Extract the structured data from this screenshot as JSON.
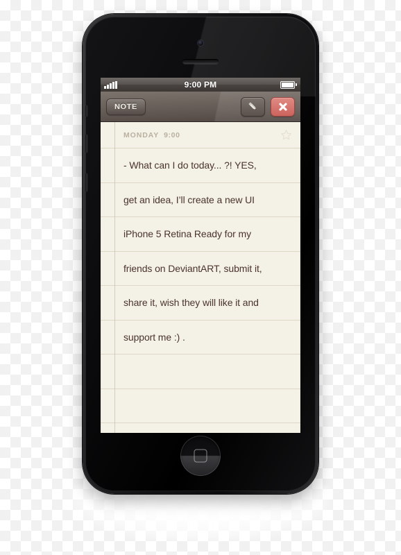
{
  "device": {
    "name": "iPhone 5 Black",
    "body_color": "#0c0c0e",
    "camera_icon": "front-camera-icon",
    "earpiece_icon": "earpiece-speaker-icon",
    "home_button_icon": "home-button-icon"
  },
  "status_bar": {
    "signal_icon": "signal-bars-icon",
    "signal_strength": 5,
    "time": "9:00 PM",
    "battery_icon": "battery-icon",
    "battery_level": 100
  },
  "toolbar": {
    "tab_label": "NOTE",
    "edit_icon": "pencil-icon",
    "delete_icon": "close-x-icon",
    "delete_color": "#cc635d"
  },
  "note": {
    "date_label": "MONDAY",
    "time_label": "9:00",
    "star_icon": "star-outline-icon",
    "lines": [
      "- What can I do today... ?!  YES,",
      "get an idea, I’ll create a new UI",
      "iPhone 5 Retina Ready for my",
      "friends on DeviantART, submit it,",
      "share it, wish they will like it and",
      "support me :) .",
      "",
      ""
    ],
    "paper_color": "#f4f1e6",
    "text_color": "#4a342c"
  }
}
